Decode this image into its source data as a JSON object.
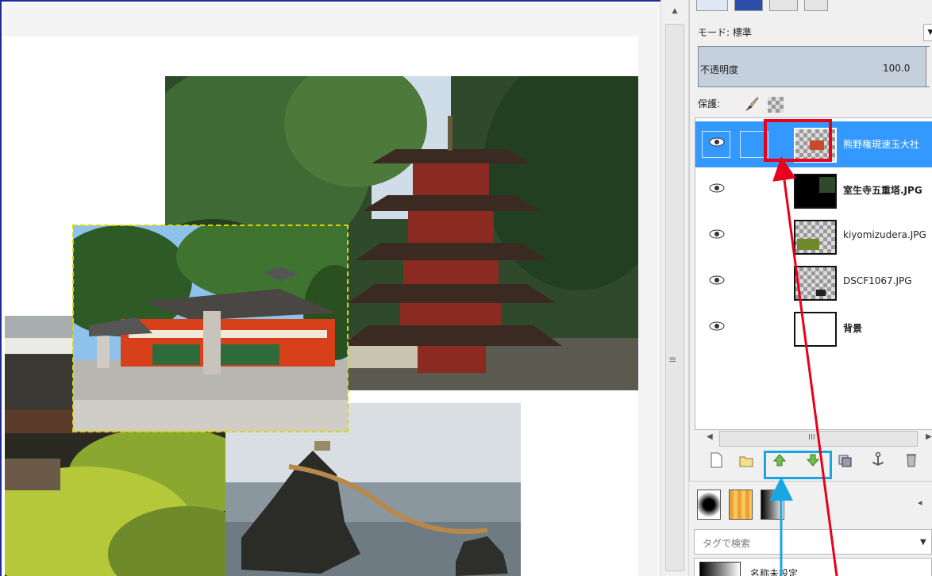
{
  "colors": {
    "accent_selection": "#3399ff",
    "highlight_red": "#e8001c",
    "highlight_cyan": "#1aa6e2",
    "frame_blue": "#1c2a9c"
  },
  "canvas": {
    "photos": [
      {
        "name": "pagoda-photo",
        "subject": "five-storied pagoda among trees"
      },
      {
        "name": "shrine-photo",
        "subject": "red shrine buildings, selected with dashed marquee"
      },
      {
        "name": "temple-photo",
        "subject": "temple roof and green maple foliage"
      },
      {
        "name": "rocks-photo",
        "subject": "wedded rocks joined by straw rope in the sea"
      }
    ]
  },
  "layers_panel": {
    "mode_label": "モード: 標準",
    "opacity_label": "不透明度",
    "opacity_value": "100.0",
    "lock_label": "保護:",
    "layers": [
      {
        "name": "熊野権現速玉大社",
        "selected": true,
        "visible": true
      },
      {
        "name": "室生寺五重塔.JPG",
        "selected": false,
        "visible": true
      },
      {
        "name": "kiyomizudera.JPG",
        "selected": false,
        "visible": true
      },
      {
        "name": "DSCF1067.JPG",
        "selected": false,
        "visible": true
      },
      {
        "name": "背景",
        "selected": false,
        "visible": true
      }
    ],
    "hscroll_grip": "III",
    "actions": [
      "new-layer-icon",
      "layer-group-icon",
      "raise-layer-icon",
      "lower-layer-icon",
      "duplicate-layer-icon",
      "anchor-icon",
      "delete-layer-icon"
    ]
  },
  "bottom_dock": {
    "tag_search_placeholder": "タグで検索",
    "gradient_name": "名称未設定"
  }
}
